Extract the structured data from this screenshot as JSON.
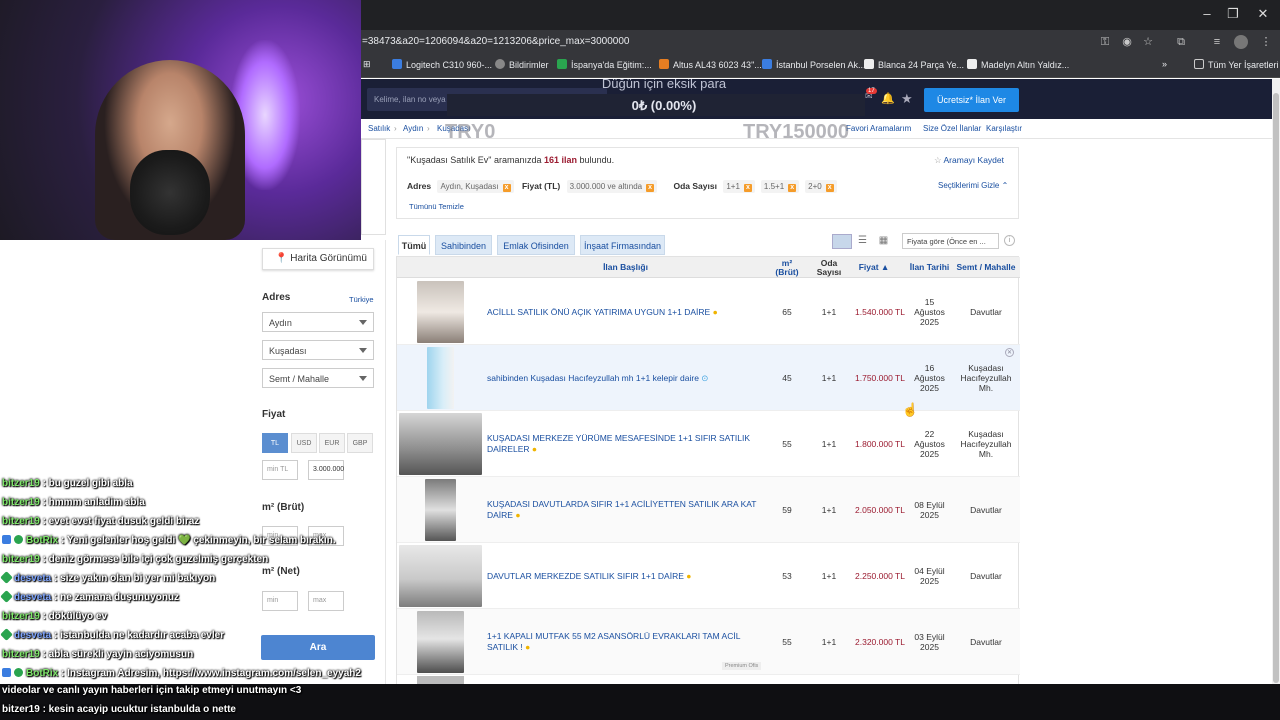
{
  "browser": {
    "url": "=38473&a20=1206094&a20=1213206&price_max=3000000",
    "bookmarks": [
      "Logitech C310 960-...",
      "Bildirimler",
      "İspanya'da Eğitim:...",
      "Altus AL43 6023 43\"...",
      "İstanbul Porselen Ak...",
      "Blanca 24 Parça Ye...",
      "Madelyn Altın Yaldız..."
    ],
    "bookmarks_more": "»",
    "all_bookmarks": "Tüm Yer İşaretleri"
  },
  "site": {
    "search_placeholder": "Kelime, ilan no veya",
    "notif_count": "17",
    "new_ad_label": "Ücretsiz* İlan Ver",
    "crumbs": [
      "Satılık",
      "Aydın",
      "Kuşadası"
    ],
    "links_right": [
      "Favori Aramalarım",
      "Size Özel İlanlar",
      "Karşılaştır"
    ],
    "brand_color": "#1e88e5"
  },
  "overlay": {
    "donate_title": "Düğün için eksik para",
    "donate_amount": "0₺ (0.00%)",
    "min": "TRY0",
    "max": "TRY150000"
  },
  "summary": {
    "query_open": "\"",
    "query": "Kuşadası Satılık Ev",
    "query_close": "\" aramanızda",
    "count": "161 ilan",
    "suffix": "bulundu.",
    "save_search": "Aramayı Kaydet",
    "filters": {
      "adres_label": "Adres",
      "adres_value": "Aydın, Kuşadası",
      "fiyat_label": "Fiyat (TL)",
      "fiyat_value": "3.000.000 ve altında",
      "oda_label": "Oda Sayısı",
      "oda_values": [
        "1+1",
        "1.5+1",
        "2+0"
      ]
    },
    "hide_selected": "Seçtiklerimi Gizle",
    "clear_all": "Tümünü Temizle"
  },
  "tabs": [
    "Tümü",
    "Sahibinden",
    "Emlak Ofisinden",
    "İnşaat Firmasından"
  ],
  "sort": "Fiyata göre (Önce en ...",
  "table": {
    "headers": {
      "title": "İlan Başlığı",
      "m2": "m²\n(Brüt)",
      "oda": "Oda\nSayısı",
      "fiyat": "Fiyat ▲",
      "tarih": "İlan Tarihi",
      "semt": "Semt / Mahalle"
    },
    "rows": [
      {
        "title": "ACİLLL SATILIK ÖNÜ AÇIK YATIRIMA UYGUN 1+1 DAİRE",
        "m2": "65",
        "oda": "1+1",
        "price": "1.540.000 TL",
        "date": "15\nAğustos\n2025",
        "loc": "Davutlar"
      },
      {
        "title": "sahibinden Kuşadası Hacıfeyzullah mh 1+1 kelepir daire",
        "m2": "45",
        "oda": "1+1",
        "price": "1.750.000 TL",
        "date": "16\nAğustos\n2025",
        "loc": "Kuşadası\nHacıfeyzullah\nMh."
      },
      {
        "title": "KUŞADASI MERKEZE YÜRÜME MESAFESİNDE 1+1 SIFIR SATILIK DAİRELER",
        "m2": "55",
        "oda": "1+1",
        "price": "1.800.000 TL",
        "date": "22\nAğustos\n2025",
        "loc": "Kuşadası\nHacıfeyzullah\nMh."
      },
      {
        "title": "KUŞADASI DAVUTLARDA SIFIR 1+1 ACİLİYETTEN SATILIK ARA KAT DAİRE",
        "m2": "59",
        "oda": "1+1",
        "price": "2.050.000 TL",
        "date": "08 Eylül\n2025",
        "loc": "Davutlar"
      },
      {
        "title": "DAVUTLAR MERKEZDE SATILIK SIFIR 1+1 DAİRE",
        "m2": "53",
        "oda": "1+1",
        "price": "2.250.000 TL",
        "date": "04 Eylül\n2025",
        "loc": "Davutlar"
      },
      {
        "title": "1+1 KAPALI MUTFAK 55 M2 ASANSÖRLÜ EVRAKLARI TAM ACİL SATILIK !",
        "m2": "55",
        "oda": "1+1",
        "price": "2.320.000 TL",
        "date": "03 Eylül\n2025",
        "loc": "Davutlar",
        "badge": "Premium Ofis"
      }
    ]
  },
  "sidebar": {
    "map_view": "Harita Görünümü",
    "adres_title": "Adres",
    "country": "Türkiye",
    "selects": [
      "Aydın",
      "Kuşadası",
      "Semt / Mahalle"
    ],
    "fiyat_title": "Fiyat",
    "currencies": [
      "TL",
      "USD",
      "EUR",
      "GBP"
    ],
    "min_tl": "min TL",
    "max_value": "3.000.000",
    "m2_brut": "m² (Brüt)",
    "m2_net": "m² (Net)",
    "min": "min",
    "max": "max",
    "search_btn": "Ara"
  },
  "chat": [
    {
      "user": "bitzer19",
      "msg": " : bu guzel gibi abla"
    },
    {
      "user": "bitzer19",
      "msg": " : hmmm anladim abla"
    },
    {
      "user": "bitzer19",
      "msg": " : evet evet fiyat dusuk geldi biraz"
    },
    {
      "user": "BotRix",
      "msg": " : Yeni gelenler hoş geldi 💚 çekinmeyin, bir selam bırakın."
    },
    {
      "user": "bitzer19",
      "msg": " : deniz görmese bile içi çok guzelmiş gerçekten"
    },
    {
      "user": "desveta",
      "msg": " : size yakın olan bi yer mi bakıyon"
    },
    {
      "user": "desveta",
      "msg": " : ne zamana duşunuyonuz"
    },
    {
      "user": "bitzer19",
      "msg": " : dökülüyo ev"
    },
    {
      "user": "desveta",
      "msg": " : istanbulda ne kadardır acaba evler"
    },
    {
      "user": "bitzer19",
      "msg": " : abla sürekli yayin aciyomusun"
    },
    {
      "user": "BotRix",
      "msg": " : Instagram Adresim, https://www.instagram.com/selen_eyyah2"
    }
  ],
  "chat_wrap": "videolar ve canlı yayın haberleri için takip etmeyi unutmayın <3",
  "footer": {
    "user": "bitzer19",
    "msg": " : kesin acayip ucuktur istanbulda o nette"
  }
}
